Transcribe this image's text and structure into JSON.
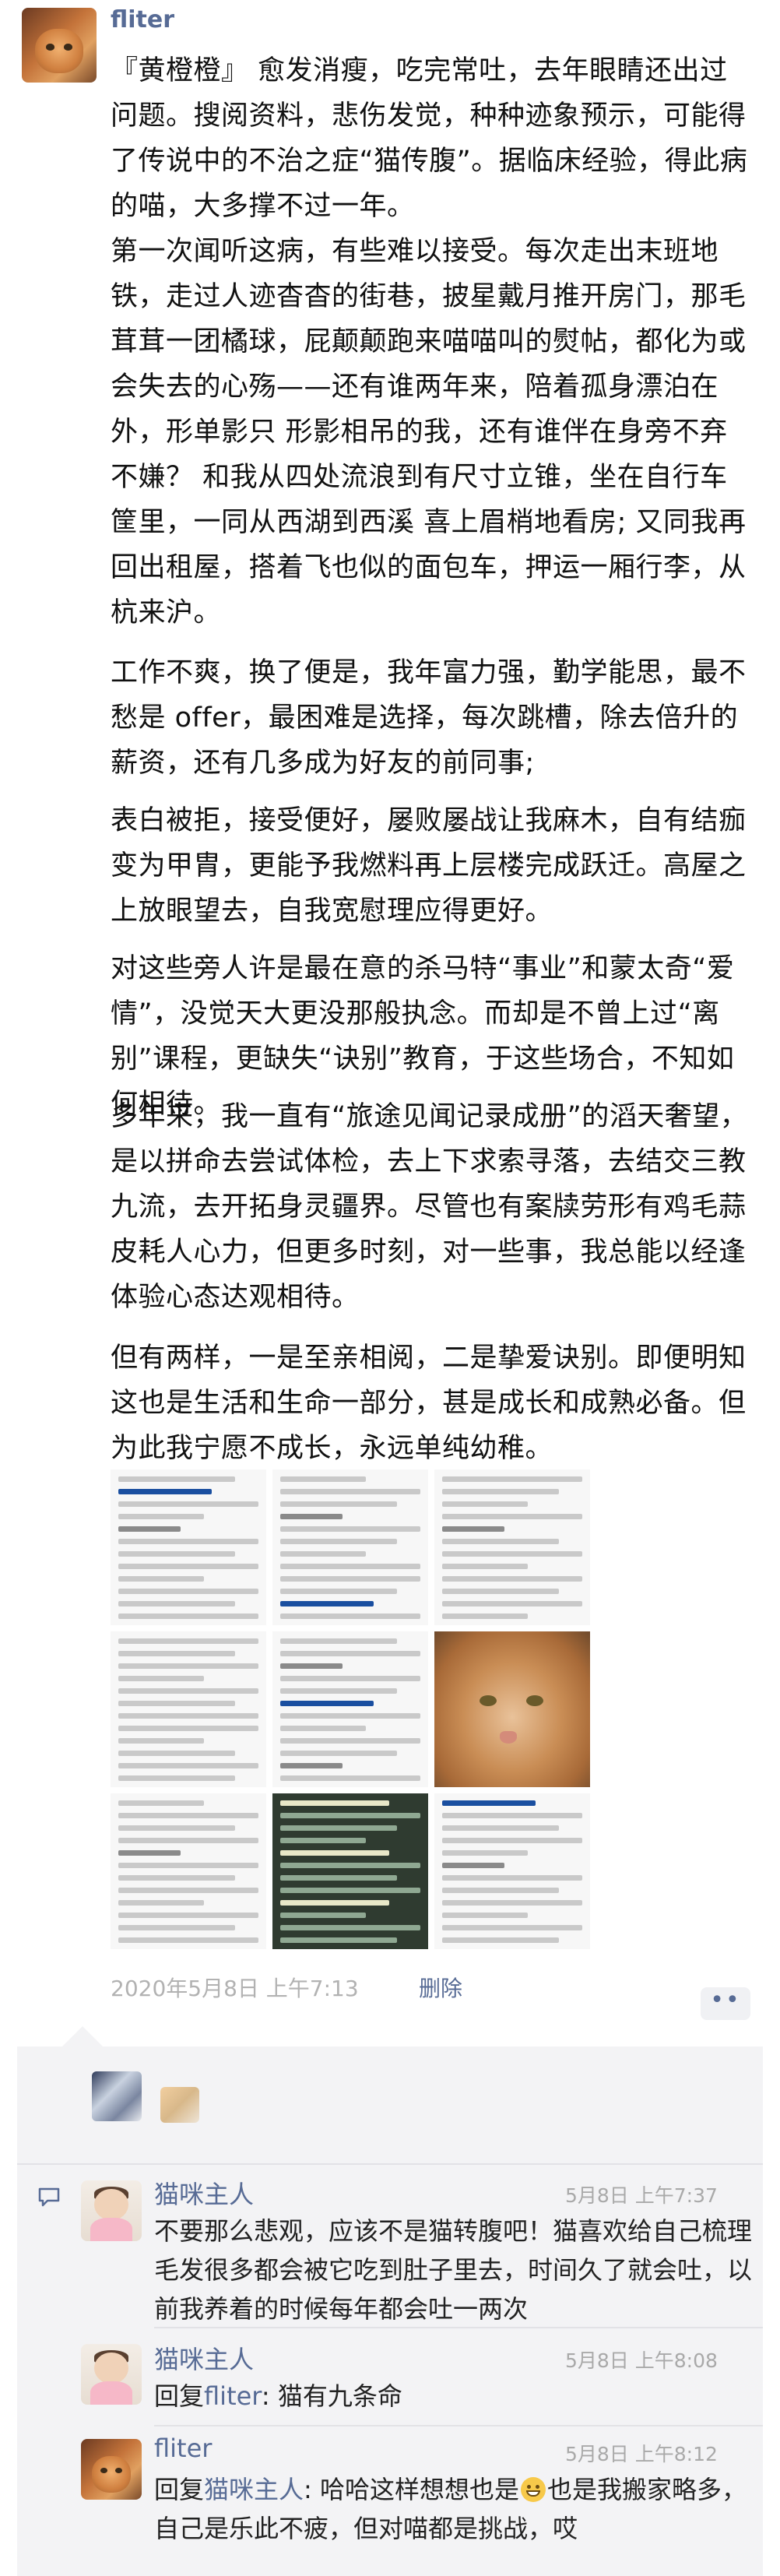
{
  "post": {
    "author": "fliter",
    "paragraphs": [
      "『黄橙橙』 愈发消瘦，吃完常吐，去年眼睛还出过问题。搜阅资料，悲伤发觉，种种迹象预示，可能得了传说中的不治之症“猫传腹”。据临床经验，得此病的喵，大多撑不过一年。",
      "第一次闻听这病，有些难以接受。每次走出末班地铁，走过人迹杳杳的街巷，披星戴月推开房门，那毛茸茸一团橘球，屁颠颠跑来喵喵叫的熨帖，都化为或会失去的心殇——还有谁两年来，陪着孤身漂泊在外，形单影只 形影相吊的我，还有谁伴在身旁不弃不嫌？ 和我从四处流浪到有尺寸立锥，坐在自行车筐里，一同从西湖到西溪 喜上眉梢地看房; 又同我再回出租屋，搭着飞也似的面包车，押运一厢行李，从杭来沪。",
      "工作不爽，换了便是，我年富力强，勤学能思，最不愁是 offer，最困难是选择，每次跳槽，除去倍升的薪资，还有几多成为好友的前同事;",
      "表白被拒，接受便好，屡败屡战让我麻木，自有结痂变为甲胄，更能予我燃料再上层楼完成跃迁。高屋之上放眼望去，自我宽慰理应得更好。",
      "对这些旁人许是最在意的杀马特“事业”和蒙太奇“爱情”，没觉天大更没那般执念。而却是不曾上过“离别”课程，更缺失“诀别”教育，于这些场合，不知如何相待。",
      "多年来，我一直有“旅途见闻记录成册”的滔天奢望，是以拼命去尝试体检，去上下求索寻落，去结交三教九流，去开拓身灵疆界。尽管也有案牍劳形有鸡毛蒜皮耗人心力，但更多时刻，对一些事，我总能以经逢体验心态达观相待。",
      "但有两样，一是至亲相阅，二是挚爱诀别。即便明知这也是生活和生命一部分，甚是成长和成熟必备。但为此我宁愿不成长，永远单纯幼稚。"
    ],
    "timestamp": "2020年5月8日 上午7:13",
    "delete_label": "删除",
    "more_label": "••"
  },
  "comments": [
    {
      "author": "猫咪主人",
      "time": "5月8日 上午7:37",
      "text": "不要那么悲观，应该不是猫转腹吧！猫喜欢给自己梳理毛发很多都会被它吃到肚子里去，时间久了就会吐，以前我养着的时候每年都会吐一两次"
    },
    {
      "author": "猫咪主人",
      "time": "5月8日 上午8:08",
      "text_prefix": "回复",
      "mention": "fliter",
      "text": ": 猫有九条命"
    },
    {
      "author": "fliter",
      "time": "5月8日 上午8:12",
      "text_prefix": "回复",
      "mention": "猫咪主人",
      "text_a": ": 哈哈这样想想也是",
      "text_b": "也是我搬家略多，自己是乐此不疲，但对喵都是挑战，哎"
    }
  ],
  "colors": {
    "link": "#576b95",
    "meta": "#b2b2b2",
    "comment_bg": "#f3f3f5"
  },
  "icons": {
    "comment_area": "comment-bubble-icon",
    "more": "more-dots-icon"
  }
}
